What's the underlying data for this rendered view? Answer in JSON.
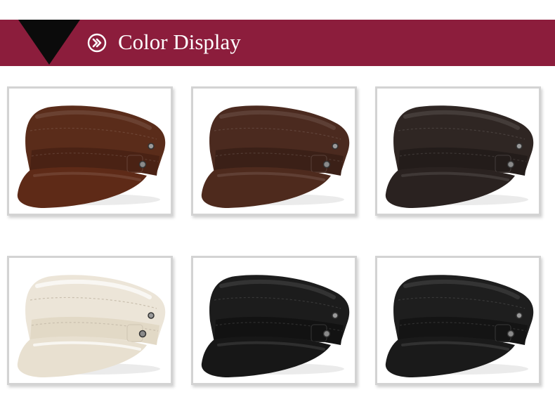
{
  "header": {
    "title": "Color Display",
    "accent_color": "#8c1d3c",
    "arrow_icon": "circle-arrow-right-icon"
  },
  "products": [
    {
      "color_name": "brown",
      "crown": "#5a2c1a",
      "visor": "#5e2a17",
      "band": "#4a2214"
    },
    {
      "color_name": "dark-brown",
      "crown": "#4b2a1f",
      "visor": "#4e2a1d",
      "band": "#3b2017"
    },
    {
      "color_name": "coffee",
      "crown": "#2f2623",
      "visor": "#2a2220",
      "band": "#231c1a"
    },
    {
      "color_name": "beige",
      "crown": "#ece5d8",
      "visor": "#e8e0d0",
      "band": "#e2d9c6"
    },
    {
      "color_name": "black",
      "crown": "#1c1c1c",
      "visor": "#171717",
      "band": "#121212"
    },
    {
      "color_name": "black-textured",
      "crown": "#1e1e1e",
      "visor": "#1a1a1a",
      "band": "#141414"
    }
  ]
}
